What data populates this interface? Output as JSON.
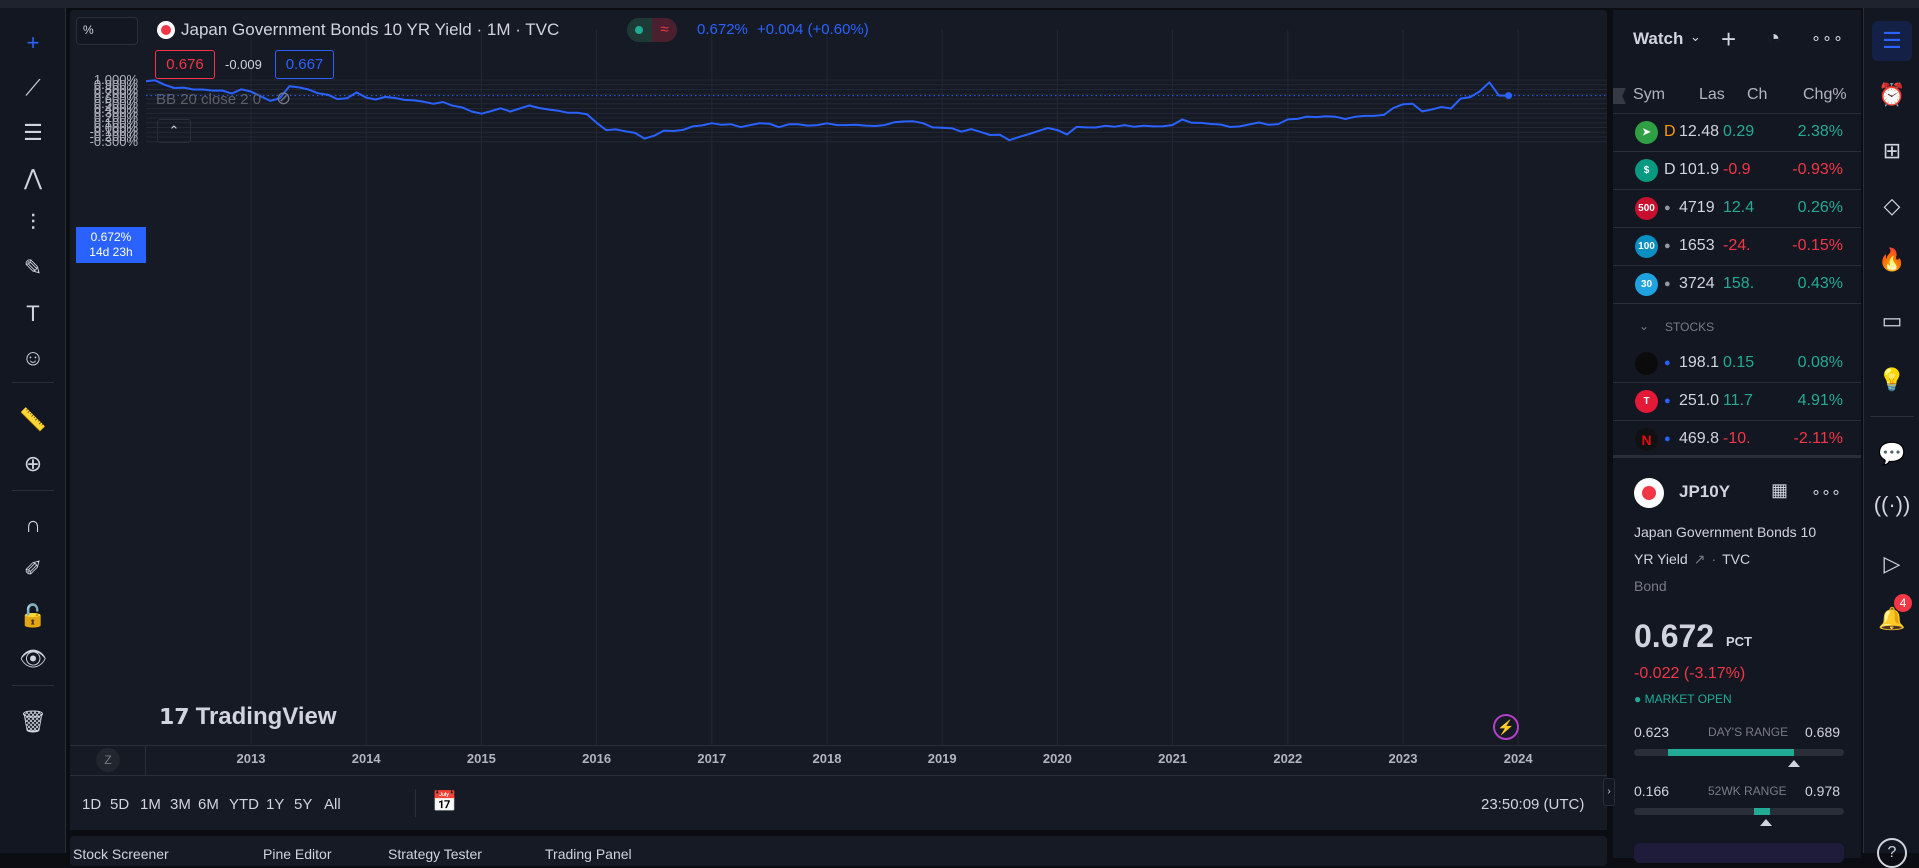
{
  "chart_header": {
    "scale_button": "%",
    "title": "Japan Government Bonds 10 YR Yield · 1M · TVC",
    "price_display": "0.672%",
    "change_display": "+0.004 (+0.60%)",
    "bid": "0.676",
    "spread": "-0.009",
    "ask": "0.667",
    "indicator": "BB 20 close 2 0",
    "current_price_label": "0.672%",
    "countdown_label": "14d 23h",
    "watermark": "TradingView"
  },
  "colors": {
    "line": "#2962ff",
    "up": "#22ab94",
    "down": "#f23645",
    "background": "#161a25"
  },
  "chart_data": {
    "type": "line",
    "title": "Japan Government Bonds 10 YR Yield · 1M · TVC",
    "xlabel": "",
    "ylabel": "",
    "ylim": [
      -0.4,
      1.1
    ],
    "y_ticks": [
      "1.000%",
      "0.900%",
      "0.800%",
      "0.700%",
      "0.600%",
      "0.500%",
      "0.400%",
      "0.300%",
      "0.200%",
      "0.100%",
      "0.000%",
      "-0.100%",
      "-0.200%",
      "-0.300%"
    ],
    "x_ticks": [
      "2013",
      "2014",
      "2015",
      "2016",
      "2017",
      "2018",
      "2019",
      "2020",
      "2021",
      "2022",
      "2023",
      "2024"
    ],
    "grid": true,
    "start": "2012-02",
    "frequency": "monthly",
    "values": [
      0.972,
      0.994,
      0.9,
      0.832,
      0.84,
      0.8,
      0.8,
      0.776,
      0.778,
      0.715,
      0.804,
      0.755,
      0.66,
      0.56,
      0.614,
      0.869,
      0.845,
      0.8,
      0.72,
      0.69,
      0.598,
      0.614,
      0.74,
      0.63,
      0.589,
      0.645,
      0.622,
      0.582,
      0.57,
      0.54,
      0.5,
      0.537,
      0.46,
      0.423,
      0.336,
      0.29,
      0.346,
      0.405,
      0.336,
      0.4,
      0.463,
      0.41,
      0.38,
      0.353,
      0.31,
      0.31,
      0.278,
      0.1,
      -0.054,
      -0.04,
      -0.08,
      -0.114,
      -0.233,
      -0.173,
      -0.065,
      -0.074,
      -0.05,
      0.023,
      0.044,
      0.091,
      0.056,
      0.07,
      0.009,
      0.05,
      0.09,
      0.079,
      0.007,
      0.067,
      0.07,
      0.04,
      0.051,
      0.088,
      0.053,
      0.051,
      0.058,
      0.039,
      0.032,
      0.051,
      0.11,
      0.127,
      0.13,
      0.091,
      0.002,
      -0.005,
      -0.014,
      -0.089,
      -0.033,
      -0.093,
      -0.158,
      -0.152,
      -0.268,
      -0.2,
      -0.14,
      -0.075,
      -0.01,
      -0.054,
      -0.145,
      0.013,
      0.002,
      0.0,
      0.035,
      0.016,
      0.05,
      0.014,
      0.037,
      0.023,
      0.025,
      0.053,
      0.168,
      0.098,
      0.097,
      0.074,
      0.064,
      0.011,
      0.023,
      0.065,
      0.106,
      0.056,
      0.072,
      0.17,
      0.182,
      0.23,
      0.218,
      0.238,
      0.226,
      0.18,
      0.225,
      0.244,
      0.244,
      0.266,
      0.41,
      0.488,
      0.499,
      0.338,
      0.378,
      0.432,
      0.399,
      0.608,
      0.64,
      0.762,
      0.952,
      0.671,
      0.672
    ],
    "last_value": 0.672
  },
  "time_axis": {
    "reset_button": "Z"
  },
  "range_bar": {
    "ranges": [
      "1D",
      "5D",
      "1M",
      "3M",
      "6M",
      "YTD",
      "1Y",
      "5Y",
      "All"
    ],
    "clock": "23:50:09 (UTC)"
  },
  "bottom_tabs": [
    "Stock Screener",
    "Pine Editor",
    "Strategy Tester",
    "Trading Panel"
  ],
  "watchlist": {
    "title": "Watch",
    "columns": [
      "Sym",
      "Las",
      "Ch",
      "Chg%"
    ],
    "rows": [
      {
        "badge": "➤",
        "badge_color": "#2ea043",
        "flag": "D",
        "last": "12.48",
        "chg": "0.29",
        "chgp": "2.38%",
        "dir": "up"
      },
      {
        "badge": "$",
        "badge_color": "#089981",
        "flag": "D",
        "last": "101.9",
        "chg": "-0.9",
        "chgp": "-0.93%",
        "dir": "down"
      },
      {
        "badge": "500",
        "badge_color": "#c8102e",
        "flag": "●",
        "last": "4719",
        "chg": "12.4",
        "chgp": "0.26%",
        "dir": "up"
      },
      {
        "badge": "100",
        "badge_color": "#0a8fc2",
        "flag": "●",
        "last": "1653",
        "chg": "-24.",
        "chgp": "-0.15%",
        "dir": "down"
      },
      {
        "badge": "30",
        "badge_color": "#1ea2e0",
        "flag": "●",
        "last": "3724",
        "chg": "158.",
        "chgp": "0.43%",
        "dir": "up"
      }
    ],
    "section": "STOCKS",
    "stock_rows": [
      {
        "badge": "",
        "badge_color": "#0b0b0b",
        "flag": "●",
        "last": "198.1",
        "chg": "0.15",
        "chgp": "0.08%",
        "dir": "up"
      },
      {
        "badge": "T",
        "badge_color": "#e31937",
        "flag": "●",
        "last": "251.0",
        "chg": "11.7",
        "chgp": "4.91%",
        "dir": "up"
      },
      {
        "badge": "N",
        "badge_color": "#111111",
        "flag": "●",
        "last": "469.8",
        "chg": "-10.",
        "chgp": "-2.11%",
        "dir": "down"
      }
    ]
  },
  "detail": {
    "symbol": "JP10Y",
    "name_line1": "Japan Government Bonds 10",
    "name_line2": "YR Yield",
    "exchange": "TVC",
    "type": "Bond",
    "price": "0.672",
    "unit": "PCT",
    "change": "-0.022 (-3.17%)",
    "status": "MARKET OPEN",
    "days_range": {
      "label": "DAY'S RANGE",
      "low": "0.623",
      "high": "0.689",
      "fill_from": 0.16,
      "fill_to": 0.76,
      "marker": 0.76
    },
    "wk52_range": {
      "label": "52WK RANGE",
      "low": "0.166",
      "high": "0.978",
      "fill_from": 0.57,
      "fill_to": 0.65,
      "marker": 0.63
    }
  },
  "alerts_badge": "4"
}
